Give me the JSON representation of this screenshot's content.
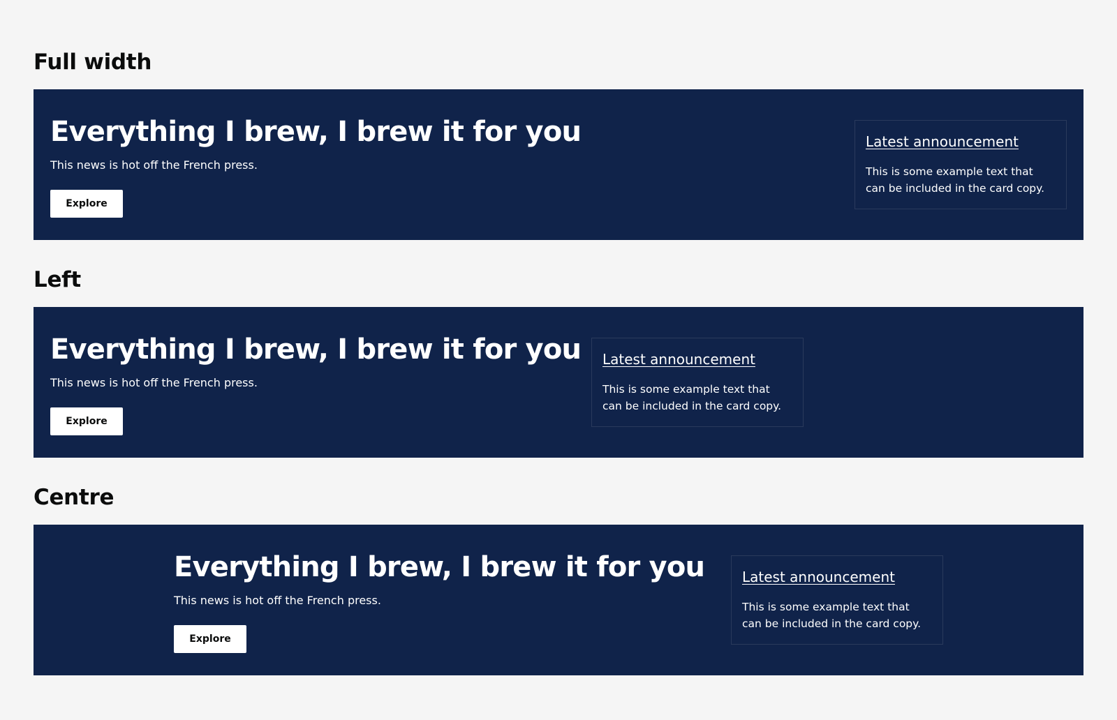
{
  "sections": [
    {
      "title": "Full width",
      "hero": {
        "heading": "Everything I brew, I brew it for you",
        "text": "This news is hot off the French press.",
        "button_label": "Explore"
      },
      "card": {
        "link_text": "Latest announcement",
        "text": "This is some example text that can be included in the card copy."
      }
    },
    {
      "title": "Left",
      "hero": {
        "heading": "Everything I brew, I brew it for you",
        "text": "This news is hot off the French press.",
        "button_label": "Explore"
      },
      "card": {
        "link_text": "Latest announcement",
        "text": "This is some example text that can be included in the card copy."
      }
    },
    {
      "title": "Centre",
      "hero": {
        "heading": "Everything I brew, I brew it for you",
        "text": "This news is hot off the French press.",
        "button_label": "Explore"
      },
      "card": {
        "link_text": "Latest announcement",
        "text": "This is some example text that can be included in the card copy."
      }
    }
  ],
  "colors": {
    "page_background": "#f5f5f5",
    "hero_background": "#10234a",
    "card_border": "#2a3a5c",
    "button_background": "#ffffff",
    "heading_text": "#0b0c0c"
  }
}
